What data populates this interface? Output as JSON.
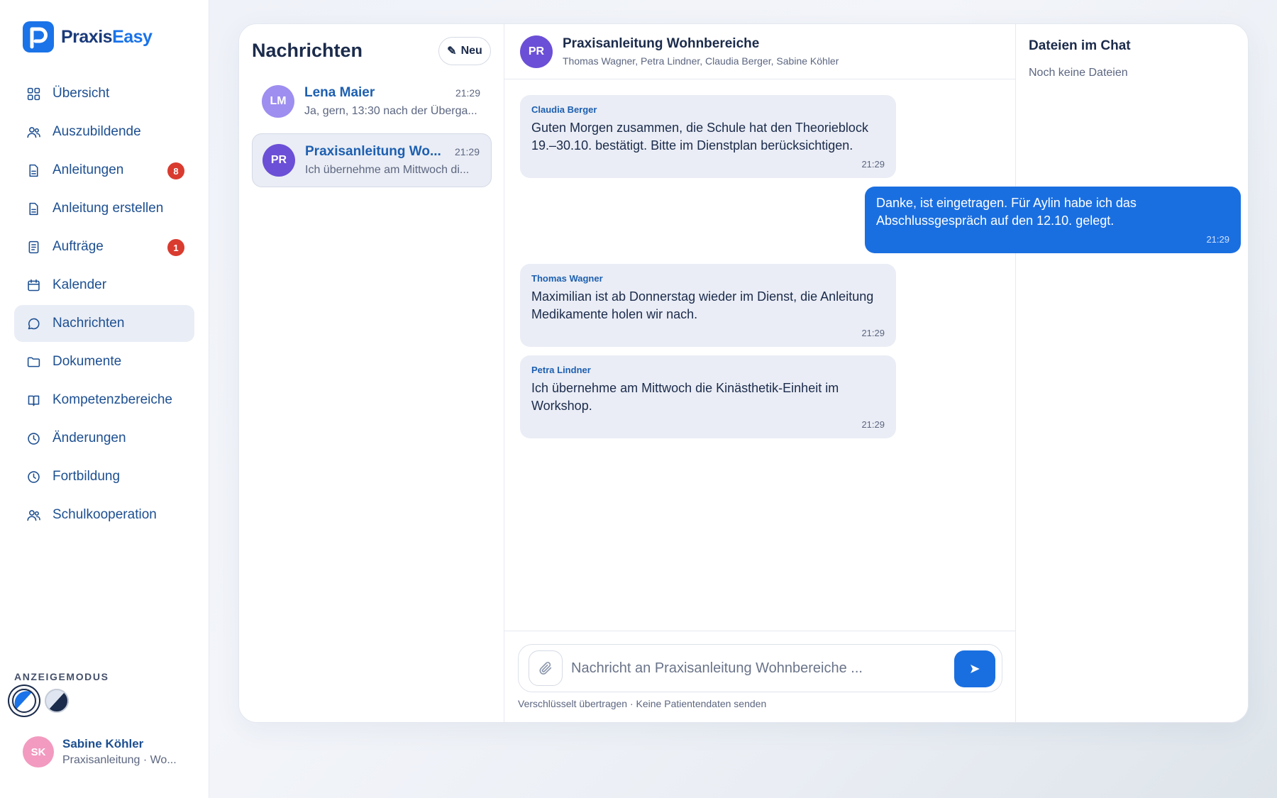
{
  "app": {
    "brand_part1": "Praxis",
    "brand_part2": "Easy",
    "accent": "#1a73e8"
  },
  "sidebar": {
    "items": [
      {
        "label": "Übersicht",
        "icon": "grid-icon"
      },
      {
        "label": "Auszubildende",
        "icon": "users-icon"
      },
      {
        "label": "Anleitungen",
        "icon": "document-icon",
        "badge": "8"
      },
      {
        "label": "Anleitung erstellen",
        "icon": "document-icon"
      },
      {
        "label": "Aufträge",
        "icon": "list-document-icon",
        "badge": "1"
      },
      {
        "label": "Kalender",
        "icon": "calendar-icon"
      },
      {
        "label": "Nachrichten",
        "icon": "chat-bubble-icon",
        "active": true
      },
      {
        "label": "Dokumente",
        "icon": "folder-icon"
      },
      {
        "label": "Kompetenzbereiche",
        "icon": "book-icon"
      },
      {
        "label": "Änderungen",
        "icon": "clock-icon"
      },
      {
        "label": "Fortbildung",
        "icon": "clock-icon"
      },
      {
        "label": "Schulkooperation",
        "icon": "users-icon"
      }
    ],
    "mode_label": "ANZEIGEMODUS",
    "user": {
      "initials": "SK",
      "name": "Sabine Köhler",
      "role": "Praxisanleitung · Wo..."
    }
  },
  "conversations": {
    "title": "Nachrichten",
    "new_label": "Neu",
    "items": [
      {
        "initials": "LM",
        "name": "Lena Maier",
        "time": "21:29",
        "preview": "Ja, gern, 13:30 nach der Überga...",
        "avatar_color": "#9d8ef0"
      },
      {
        "initials": "PR",
        "name": "Praxisanleitung Wo...",
        "time": "21:29",
        "preview": "Ich übernehme am Mittwoch di...",
        "avatar_color": "#6b4fd6",
        "selected": true
      }
    ]
  },
  "chat": {
    "initials": "PR",
    "title": "Praxisanleitung Wohnbereiche",
    "members": "Thomas Wagner, Petra Lindner, Claudia Berger, Sabine Köhler",
    "messages": [
      {
        "direction": "in",
        "sender": "Claudia Berger",
        "text": "Guten Morgen zusammen, die Schule hat den Theorieblock 19.–30.10. bestätigt. Bitte im Dienstplan berücksichtigen.",
        "time": "21:29"
      },
      {
        "direction": "out",
        "sender": "",
        "text": "Danke, ist eingetragen. Für Aylin habe ich das Abschlussgespräch auf den 12.10. gelegt.",
        "time": "21:29"
      },
      {
        "direction": "in",
        "sender": "Thomas Wagner",
        "text": "Maximilian ist ab Donnerstag wieder im Dienst, die Anleitung Medikamente holen wir nach.",
        "time": "21:29"
      },
      {
        "direction": "in",
        "sender": "Petra Lindner",
        "text": "Ich übernehme am Mittwoch die Kinästhetik-Einheit im Workshop.",
        "time": "21:29"
      }
    ],
    "input_placeholder": "Nachricht an Praxisanleitung Wohnbereiche ...",
    "input_value": "",
    "note": "Verschlüsselt übertragen · Keine Patientendaten senden"
  },
  "files": {
    "title": "Dateien im Chat",
    "empty": "Noch keine Dateien"
  }
}
